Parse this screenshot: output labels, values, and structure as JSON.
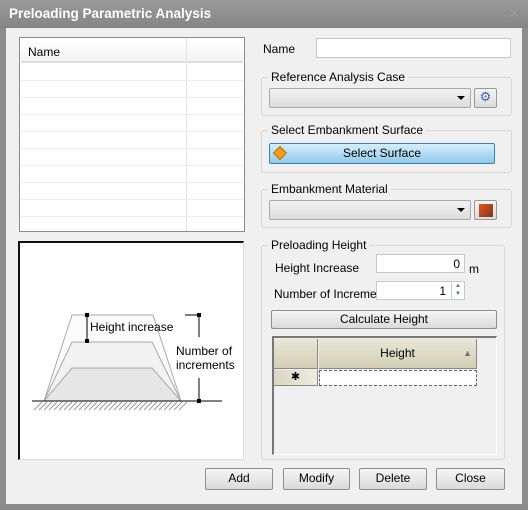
{
  "window": {
    "title": "Preloading Parametric Analysis"
  },
  "list": {
    "header": "Name"
  },
  "diagram": {
    "height_increase": "Height increase",
    "num_line1": "Number of",
    "num_line2": "increments"
  },
  "form": {
    "name_label": "Name",
    "name_value": "",
    "ref_group": "Reference Analysis Case",
    "ref_value": "",
    "surface_group": "Select Embankment Surface",
    "select_surface": "Select Surface",
    "material_group": "Embankment Material",
    "material_value": "",
    "preload_group": "Preloading Height",
    "height_increase_label": "Height Increase",
    "height_increase_value": "0",
    "unit": "m",
    "num_increment_label": "Number of Increment",
    "num_increment_value": "1",
    "calc_button": "Calculate Height",
    "grid": {
      "column": "Height",
      "new_row_marker": "✱"
    }
  },
  "buttons": {
    "add": "Add",
    "modify": "Modify",
    "delete": "Delete",
    "close": "Close"
  }
}
